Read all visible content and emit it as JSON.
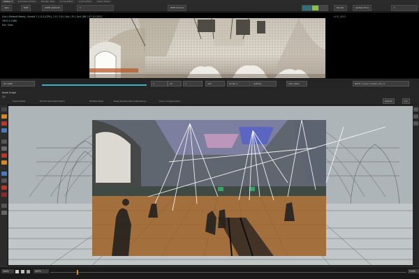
{
  "tabs": [
    {
      "label": "Viewer 1"
    },
    {
      "label": "Animation Editor"
    },
    {
      "label": "Render View"
    },
    {
      "label": "Curve Editor"
    },
    {
      "label": "Comp Editor"
    },
    {
      "label": "Dope Sheet"
    }
  ],
  "toolbar": {
    "layer_select": "rgba",
    "channel_select": "RGB",
    "colorspace": "sRGB (default)",
    "camera": "RGB Camera",
    "mode": "Render",
    "render_toggle": "Update Time",
    "gain": "1"
  },
  "viewer": {
    "info_line1": "(Scn) Default Rearly, Arnold 7.1.3.2 [CPU], 1.0 | 1/0 | Spc | Tri | 3rd | Bit | 07-10-2022",
    "info_line2": "1920 x 1080",
    "info_line3": "Ext: Over",
    "status_right": "AOV_0001"
  },
  "timeline": {
    "format": "HD 1080",
    "frame": "1",
    "fps": "24",
    "range_start": "1",
    "range_end": "100",
    "script": "Script: 1",
    "colorspace": "ACEScg",
    "right_label": "ROOT | Cycle | Script | 24 | 4"
  },
  "node_strip": {
    "title": "Node Graph",
    "breadcrumb": "3D",
    "tabs": [
      {
        "label": "Scene Mode"
      },
      {
        "label": "Mr Full Set Amend Pitch"
      },
      {
        "label": "Window Flare"
      },
      {
        "label": "Deep Position Mono Rendering"
      },
      {
        "label": "Color Compensation"
      }
    ],
    "mode_label": "default",
    "zoom_label": "1:1"
  },
  "bottom": {
    "start": "1001",
    "frame": "1075",
    "end": "1100",
    "controls": [
      "play",
      "stop",
      "next"
    ]
  },
  "colors": {
    "accent": "#3fb0c2",
    "tool_red": "#b33a2a",
    "tool_orange": "#d08a2a",
    "tool_blue": "#4a78b8"
  }
}
